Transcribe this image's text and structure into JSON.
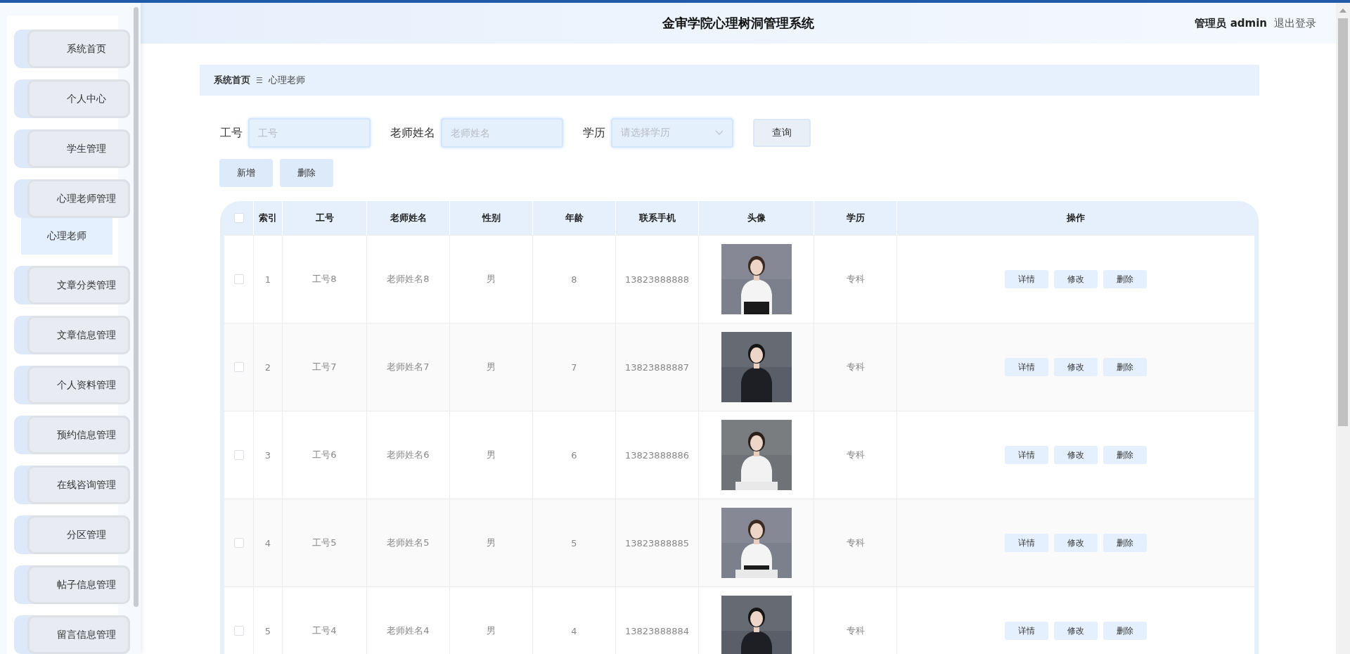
{
  "sidebar": {
    "items": [
      {
        "label": "系统首页"
      },
      {
        "label": "个人中心"
      },
      {
        "label": "学生管理"
      },
      {
        "label": "心理老师管理",
        "children": [
          {
            "label": "心理老师",
            "selected": true
          }
        ]
      },
      {
        "label": "文章分类管理"
      },
      {
        "label": "文章信息管理"
      },
      {
        "label": "个人资料管理"
      },
      {
        "label": "预约信息管理"
      },
      {
        "label": "在线咨询管理"
      },
      {
        "label": "分区管理"
      },
      {
        "label": "帖子信息管理"
      },
      {
        "label": "留言信息管理"
      }
    ]
  },
  "header": {
    "title": "金审学院心理树洞管理系统",
    "user": "管理员 admin",
    "logout": "退出登录"
  },
  "breadcrumb": {
    "home": "系统首页",
    "separator": "☰",
    "current": "心理老师"
  },
  "search": {
    "fields": [
      {
        "kind": "input",
        "label": "工号",
        "placeholder": "工号"
      },
      {
        "kind": "input",
        "label": "老师姓名",
        "placeholder": "老师姓名"
      },
      {
        "kind": "select",
        "label": "学历",
        "placeholder": "请选择学历"
      }
    ],
    "button": "查询"
  },
  "actions": [
    "新增",
    "删除"
  ],
  "table": {
    "header_checked": false,
    "columns": [
      "索引",
      "工号",
      "老师姓名",
      "性别",
      "年龄",
      "联系手机",
      "头像",
      "学历",
      "操作"
    ],
    "rows": [
      {
        "checked": false,
        "index": "1",
        "id": "工号8",
        "name": "老师姓名8",
        "gender": "男",
        "age": "8",
        "phone": "13823888888",
        "education": "专科",
        "buttons": [
          "详情",
          "修改",
          "删除"
        ]
      },
      {
        "checked": false,
        "index": "2",
        "id": "工号7",
        "name": "老师姓名7",
        "gender": "男",
        "age": "7",
        "phone": "13823888887",
        "education": "专科",
        "buttons": [
          "详情",
          "修改",
          "删除"
        ]
      },
      {
        "checked": false,
        "index": "3",
        "id": "工号6",
        "name": "老师姓名6",
        "gender": "男",
        "age": "6",
        "phone": "13823888886",
        "education": "专科",
        "buttons": [
          "详情",
          "修改",
          "删除"
        ]
      },
      {
        "checked": false,
        "index": "4",
        "id": "工号5",
        "name": "老师姓名5",
        "gender": "男",
        "age": "5",
        "phone": "13823888885",
        "education": "专科",
        "buttons": [
          "详情",
          "修改",
          "删除"
        ]
      },
      {
        "checked": false,
        "index": "5",
        "id": "工号4",
        "name": "老师姓名4",
        "gender": "男",
        "age": "4",
        "phone": "13823888884",
        "education": "专科",
        "buttons": [
          "详情",
          "修改",
          "删除"
        ]
      }
    ]
  }
}
